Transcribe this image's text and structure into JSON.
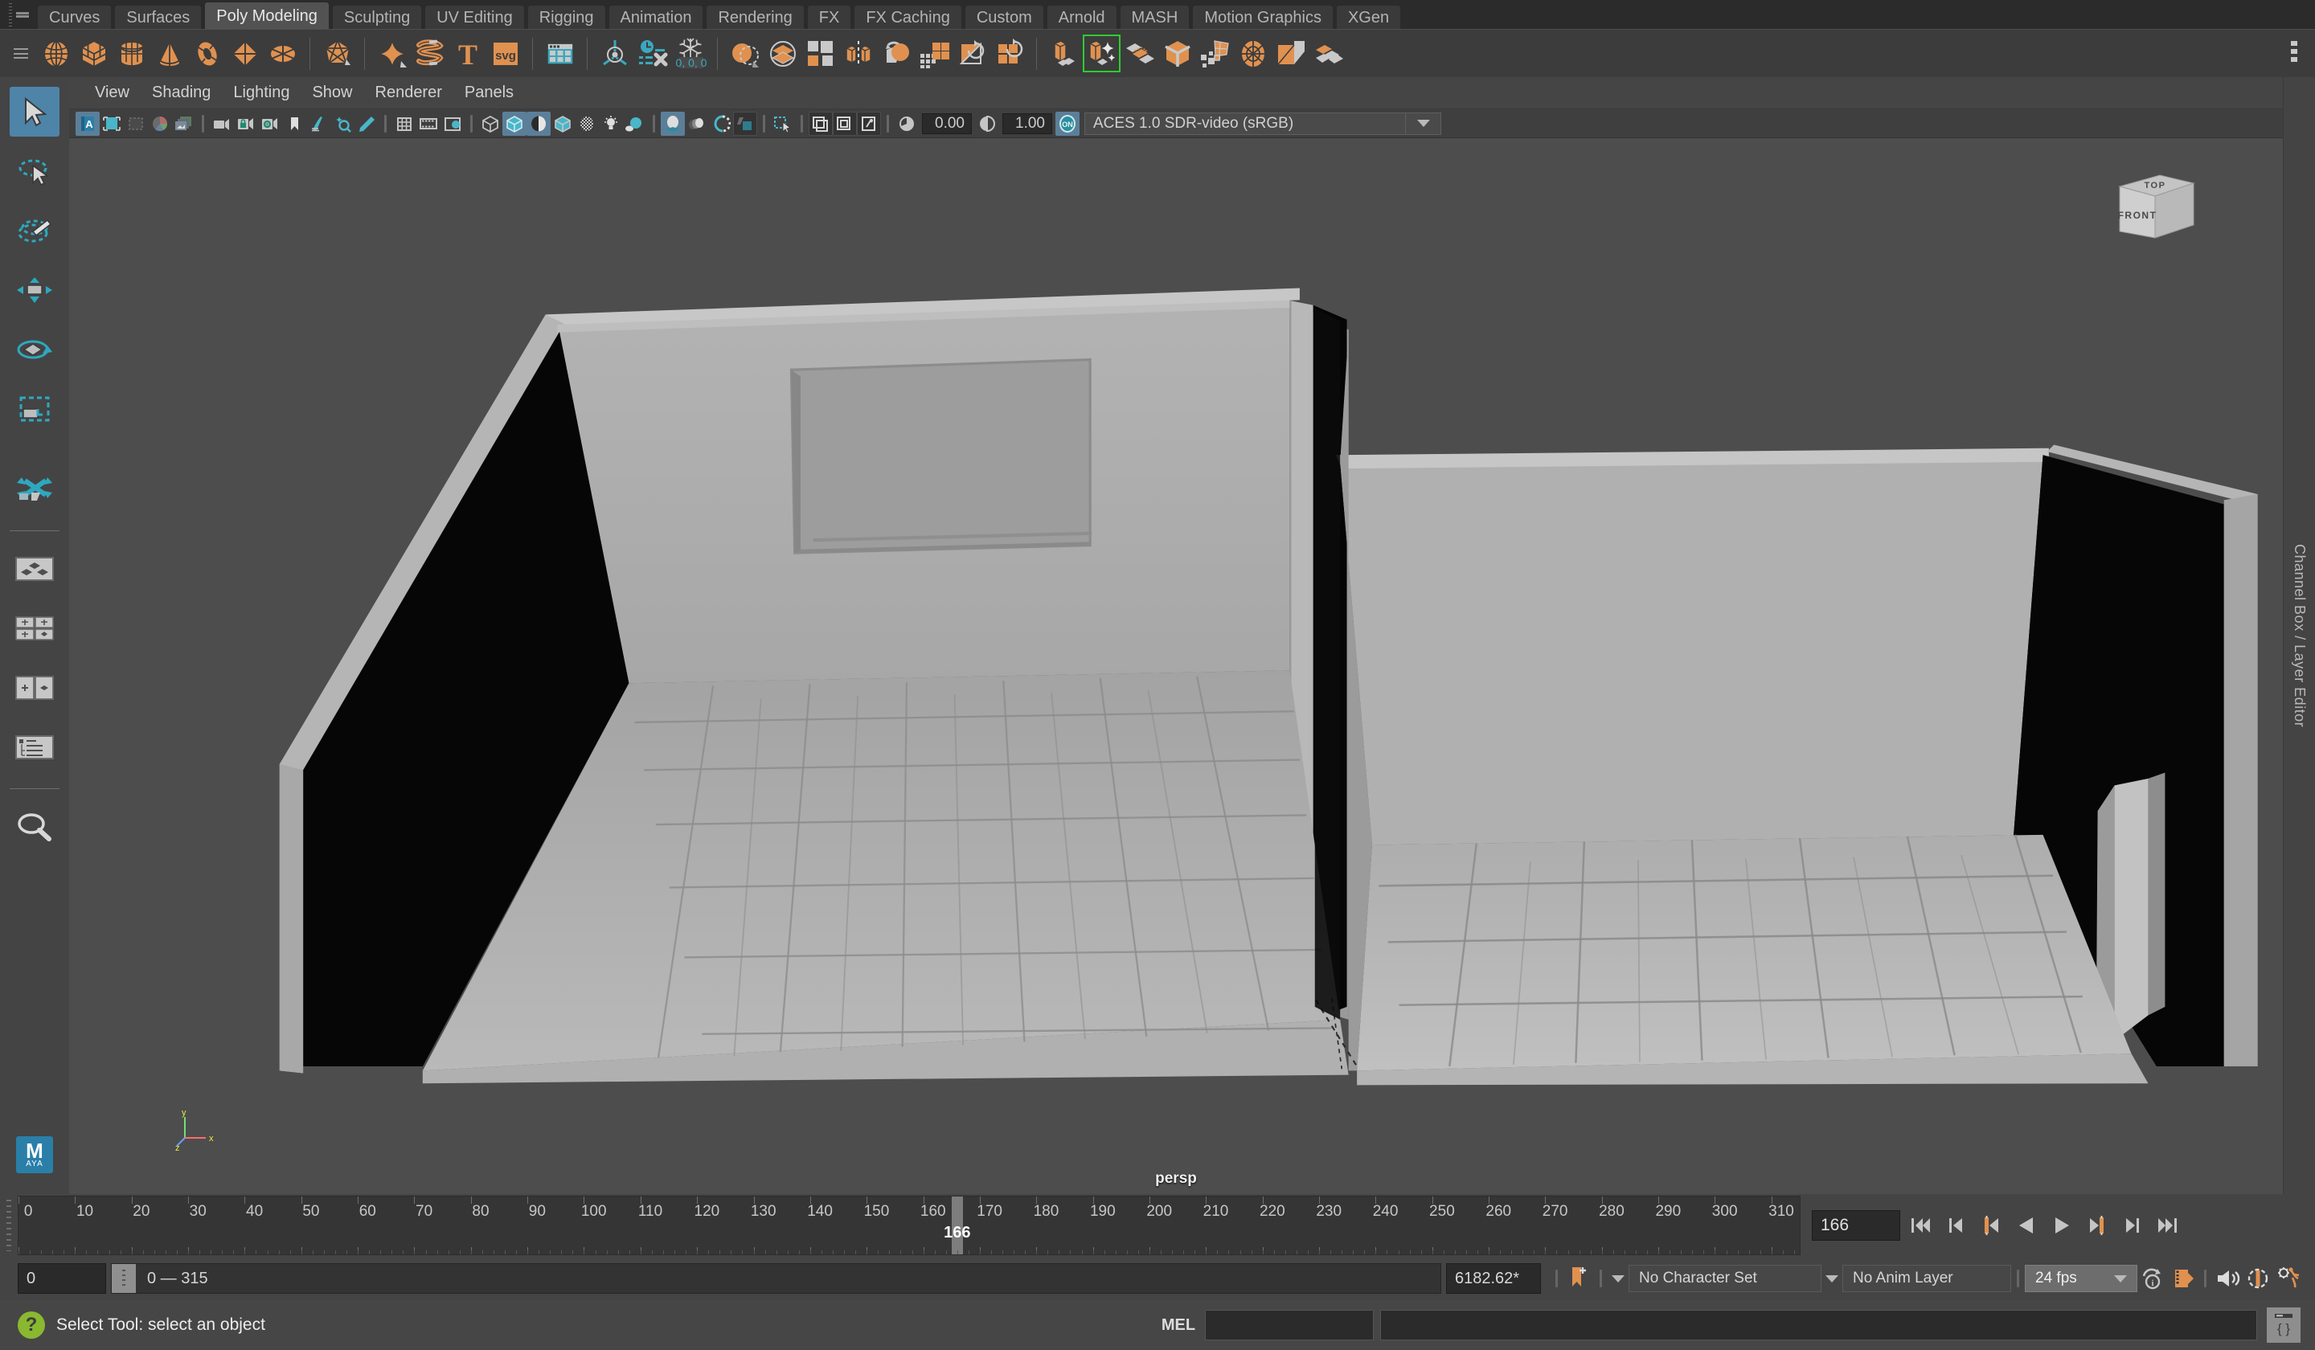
{
  "app": {
    "name": "Autodesk Maya",
    "accent": "#e08f4e",
    "ui_bg": "#444444",
    "highlight": "#5b7f99"
  },
  "shelf_tabs": [
    {
      "label": "Curves",
      "active": false
    },
    {
      "label": "Surfaces",
      "active": false
    },
    {
      "label": "Poly Modeling",
      "active": true
    },
    {
      "label": "Sculpting",
      "active": false
    },
    {
      "label": "UV Editing",
      "active": false
    },
    {
      "label": "Rigging",
      "active": false
    },
    {
      "label": "Animation",
      "active": false
    },
    {
      "label": "Rendering",
      "active": false
    },
    {
      "label": "FX",
      "active": false
    },
    {
      "label": "FX Caching",
      "active": false
    },
    {
      "label": "Custom",
      "active": false
    },
    {
      "label": "Arnold",
      "active": false
    },
    {
      "label": "MASH",
      "active": false
    },
    {
      "label": "Motion Graphics",
      "active": false
    },
    {
      "label": "XGen",
      "active": false
    }
  ],
  "shelf_icons": [
    {
      "name": "poly-sphere-icon",
      "group": 1
    },
    {
      "name": "poly-cube-icon",
      "group": 1
    },
    {
      "name": "poly-cylinder-icon",
      "group": 1
    },
    {
      "name": "poly-cone-icon",
      "group": 1
    },
    {
      "name": "poly-torus-icon",
      "group": 1
    },
    {
      "name": "poly-plane-icon",
      "group": 1
    },
    {
      "name": "poly-disc-icon",
      "group": 1
    },
    {
      "name": "poly-platonic-icon",
      "group": 2
    },
    {
      "name": "poly-soft-body-icon",
      "group": 3
    },
    {
      "name": "poly-helix-icon",
      "group": 3
    },
    {
      "name": "poly-text-icon",
      "group": 3,
      "glyph": "T"
    },
    {
      "name": "poly-svg-icon",
      "group": 3,
      "glyph": "svg"
    },
    {
      "name": "content-browser-icon",
      "group": 4
    },
    {
      "name": "center-pivot-icon",
      "group": 5
    },
    {
      "name": "delete-history-icon",
      "group": 5
    },
    {
      "name": "freeze-transformations-icon",
      "group": 5,
      "glyph": "0, 0, 0"
    },
    {
      "name": "boolean-icon",
      "group": 6
    },
    {
      "name": "combine-icon",
      "group": 6
    },
    {
      "name": "separate-icon",
      "group": 6
    },
    {
      "name": "mirror-icon",
      "group": 6
    },
    {
      "name": "smooth-icon",
      "group": 6
    },
    {
      "name": "reduce-icon",
      "group": 6
    },
    {
      "name": "triangulate-icon",
      "group": 6
    },
    {
      "name": "quadrangulate-icon",
      "group": 6
    },
    {
      "name": "extrude-icon",
      "group": 7
    },
    {
      "name": "extrude-options-icon",
      "group": 7,
      "selected": true
    },
    {
      "name": "bevel-icon",
      "group": 7
    },
    {
      "name": "bridge-icon",
      "group": 7
    },
    {
      "name": "multi-cut-icon",
      "group": 7
    },
    {
      "name": "circularize-icon",
      "group": 7
    },
    {
      "name": "wedge-icon",
      "group": 7
    },
    {
      "name": "detach-icon",
      "group": 7
    }
  ],
  "toolbox": [
    {
      "name": "select-tool",
      "label": "Select Tool",
      "active": true
    },
    {
      "name": "lasso-select-tool",
      "label": "Lasso Select Tool",
      "active": false
    },
    {
      "name": "paint-select-tool",
      "label": "Paint Select Tool",
      "active": false
    },
    {
      "name": "move-tool",
      "label": "Move Tool",
      "active": false
    },
    {
      "name": "rotate-tool",
      "label": "Rotate Tool",
      "active": false
    },
    {
      "name": "scale-tool",
      "label": "Scale Tool",
      "active": false
    },
    {
      "name": "last-tool-used",
      "label": "Last Tool Used",
      "active": false
    },
    {
      "name": "single-perspective-layout",
      "label": "Single Perspective View",
      "active": false
    },
    {
      "name": "four-view-layout",
      "label": "Four View Layout",
      "active": false
    },
    {
      "name": "persp-outliner-layout",
      "label": "Persp / Outliner Layout",
      "active": false
    },
    {
      "name": "hypergraph-layout",
      "label": "Outliner Layout",
      "active": false
    },
    {
      "name": "zoom-tool",
      "label": "Zoom",
      "active": false
    }
  ],
  "panel_menu": [
    "View",
    "Shading",
    "Lighting",
    "Show",
    "Renderer",
    "Panels"
  ],
  "viewport_toolbar": {
    "exposure_value": "0.00",
    "gamma_value": "1.00",
    "color_management_state": "ON",
    "color_space": "ACES 1.0 SDR-video (sRGB)",
    "icons_left": [
      "select-camera-icon",
      "image-plane-icon",
      "two-dimensional-pan-zoom-icon",
      "grease-pencil-icon",
      "image-sequence-icon",
      "camera-icon",
      "lock-camera-icon",
      "camera-attributes-icon",
      "bookmark-icon",
      "paint-effects-icon",
      "exposure-tool-icon",
      "pencil-tool-icon",
      "grid-icon",
      "film-gate-icon",
      "resolution-gate-icon"
    ],
    "icons_shading": [
      {
        "name": "wireframe-icon",
        "on": false
      },
      {
        "name": "smooth-shade-icon",
        "on": true
      },
      {
        "name": "shade-wireframe-icon",
        "on": true
      },
      {
        "name": "textured-icon",
        "on": false
      },
      {
        "name": "transparency-icon",
        "on": false
      },
      {
        "name": "use-default-light-icon",
        "on": false
      },
      {
        "name": "shadows-icon",
        "on": false
      },
      {
        "name": "screen-space-ao-icon",
        "on": true
      },
      {
        "name": "motion-blur-icon",
        "on": false
      },
      {
        "name": "multisample-aa-icon",
        "on": false
      },
      {
        "name": "depth-of-field-icon",
        "on": false
      },
      {
        "name": "isolate-select-icon",
        "on": false
      },
      {
        "name": "xray-icon",
        "on": false
      },
      {
        "name": "xray-joints-icon",
        "on": false
      },
      {
        "name": "xray-active-components-icon",
        "on": false
      }
    ]
  },
  "viewport": {
    "camera_label": "persp",
    "viewcube_top_label": "TOP",
    "viewcube_front_label": "FRONT",
    "axis_x_label": "x",
    "axis_y_label": "y",
    "axis_z_label": "z",
    "background_color": "#4d4d4d"
  },
  "right_rail": {
    "label": "Channel Box / Layer Editor"
  },
  "timeline": {
    "ticks": [
      0,
      10,
      20,
      30,
      40,
      50,
      60,
      70,
      80,
      90,
      100,
      110,
      120,
      130,
      140,
      150,
      160,
      170,
      180,
      190,
      200,
      210,
      220,
      230,
      240,
      250,
      260,
      270,
      280,
      290,
      300,
      310
    ],
    "min": 0,
    "max": 315,
    "current_frame": "166",
    "current_frame_field": "166",
    "playback_buttons": [
      "go-to-start-button",
      "step-back-keyframe-button",
      "step-back-frame-button",
      "play-backwards-button",
      "play-forwards-button",
      "step-forward-frame-button",
      "step-forward-keyframe-button",
      "go-to-end-button"
    ]
  },
  "range": {
    "start_value": "0",
    "range_label": "0 — 315",
    "end_value": "6182.62*",
    "character_set": "No Character Set",
    "anim_layer": "No Anim Layer",
    "fps": "24 fps",
    "icons": [
      "auto-keyframe-icon",
      "animation-preferences-icon",
      "playblast-icon",
      "audio-icon",
      "anim-snap-icon",
      "anim-settings-icon"
    ]
  },
  "status": {
    "help_glyph": "?",
    "message": "Select Tool: select an object",
    "mel_label": "MEL",
    "mel_input_value": "",
    "script_editor_glyph": "{ }"
  }
}
